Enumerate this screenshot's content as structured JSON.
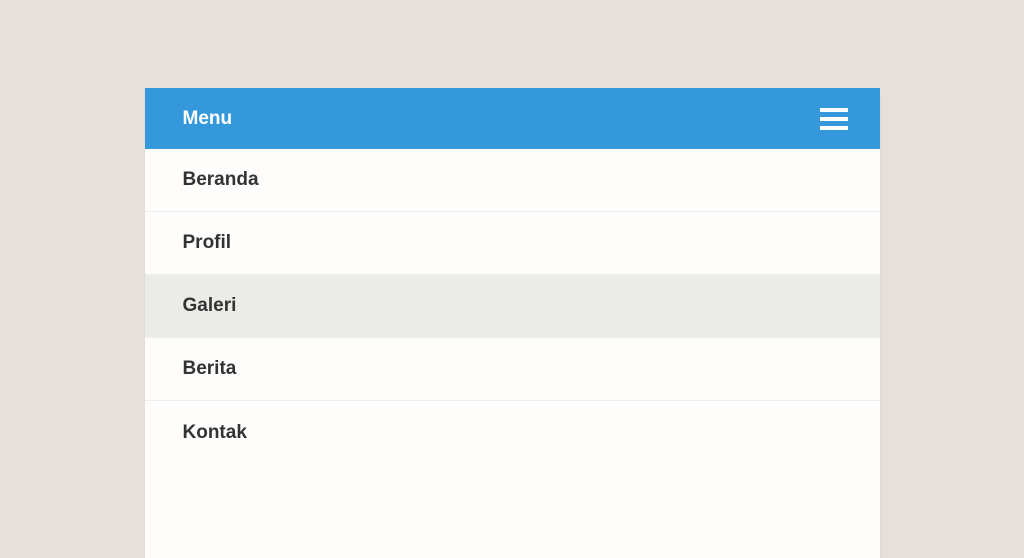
{
  "header": {
    "title": "Menu"
  },
  "items": [
    {
      "label": "Beranda",
      "hovered": false
    },
    {
      "label": "Profil",
      "hovered": false
    },
    {
      "label": "Galeri",
      "hovered": true
    },
    {
      "label": "Berita",
      "hovered": false
    },
    {
      "label": "Kontak",
      "hovered": false
    }
  ]
}
